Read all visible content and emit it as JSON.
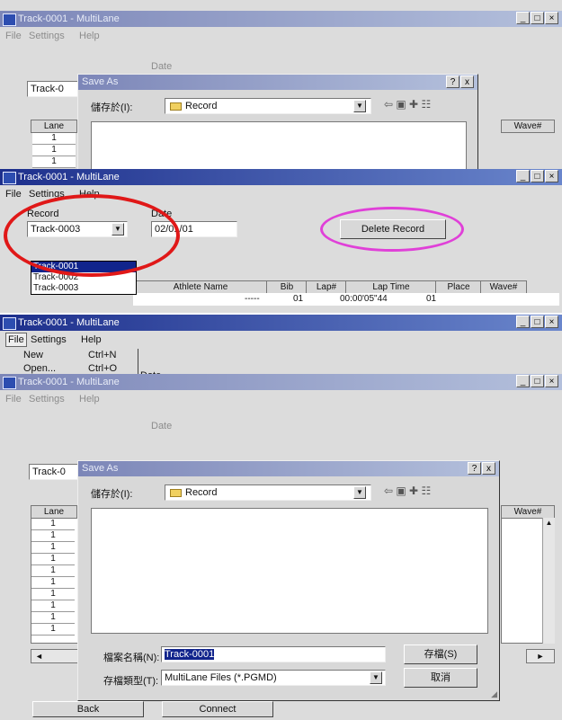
{
  "window": {
    "title": "Track-0001 - MultiLane",
    "menu": {
      "file": "File",
      "settings": "Settings",
      "help": "Help"
    }
  },
  "record": {
    "record_label": "Record",
    "date_label": "Date",
    "selected_record": "Track-0003",
    "dropdown_items": [
      "Track-0001",
      "Track-0002",
      "Track-0003"
    ],
    "date_value": "02/01/01",
    "delete_button": "Delete Record",
    "track_partial": "Track-0"
  },
  "table": {
    "headers": [
      "Lane",
      "Athlete Name",
      "Bib",
      "Lap#",
      "Lap Time",
      "Place",
      "Wave#"
    ],
    "row": {
      "bib": "-----",
      "lap": "01",
      "lap_time": "00:00'05\"44",
      "place": "01"
    },
    "lanes": [
      "1",
      "1",
      "1",
      "1",
      "1",
      "1",
      "1",
      "1",
      "1",
      "1",
      "1"
    ]
  },
  "file_menu": [
    {
      "label": "New",
      "shortcut": "Ctrl+N"
    },
    {
      "label": "Open...",
      "shortcut": "Ctrl+O"
    }
  ],
  "save_dialog": {
    "title": "Save As",
    "help_btn": "?",
    "close_btn": "x",
    "save_in_label": "儲存於(I):",
    "folder": "Record",
    "filename_label": "檔案名稱(N):",
    "filename_value": "Track-0001",
    "filetype_label": "存檔類型(T):",
    "filetype_value": "MultiLane Files (*.PGMD)",
    "save_button": "存檔(S)",
    "cancel_button": "取消"
  },
  "bottom": {
    "back_button": "Back",
    "connect_button": "Connect"
  },
  "colors": {
    "red_highlight": "#e01818",
    "magenta_highlight": "#e040d8"
  }
}
